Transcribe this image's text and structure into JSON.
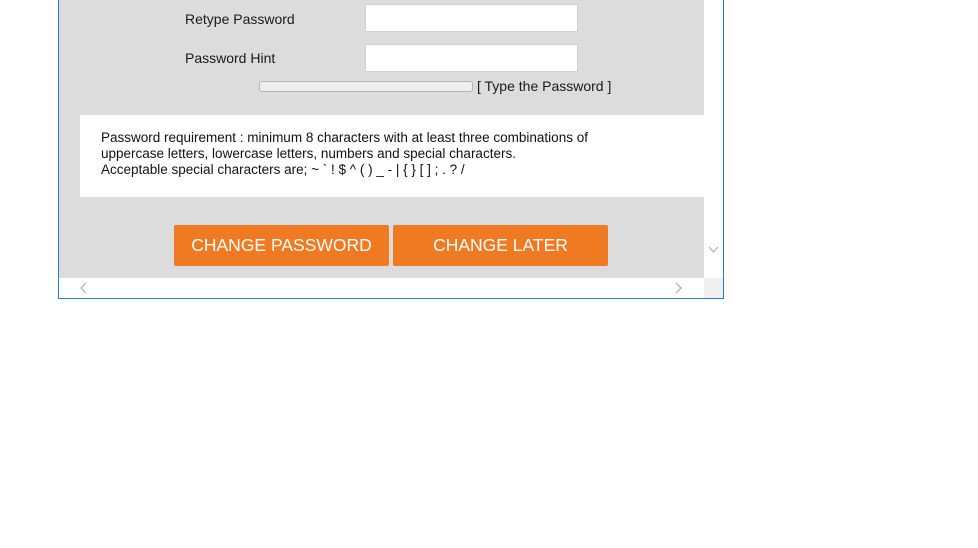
{
  "form": {
    "retype_password_label": "Retype Password",
    "retype_password_value": "",
    "password_hint_label": "Password Hint",
    "password_hint_value": "",
    "strength_text": "[ Type the Password ]",
    "strength_level": 0
  },
  "requirements": {
    "line1": "Password requirement : minimum 8 characters with at least three combinations of",
    "line2": "uppercase letters, lowercase letters, numbers and special characters.",
    "line3": "Acceptable special characters are; ~ ` ! $ ^ ( ) _ - | { } [ ] ; . ? /"
  },
  "buttons": {
    "change_password": "CHANGE PASSWORD",
    "change_later": "CHANGE LATER"
  },
  "colors": {
    "accent": "#f07a22",
    "panel_bg": "#dcdcdc",
    "window_border": "#2b79d6"
  },
  "icons": {
    "scroll_down": "chevron-down-icon",
    "scroll_left": "chevron-left-icon",
    "scroll_right": "chevron-right-icon"
  }
}
